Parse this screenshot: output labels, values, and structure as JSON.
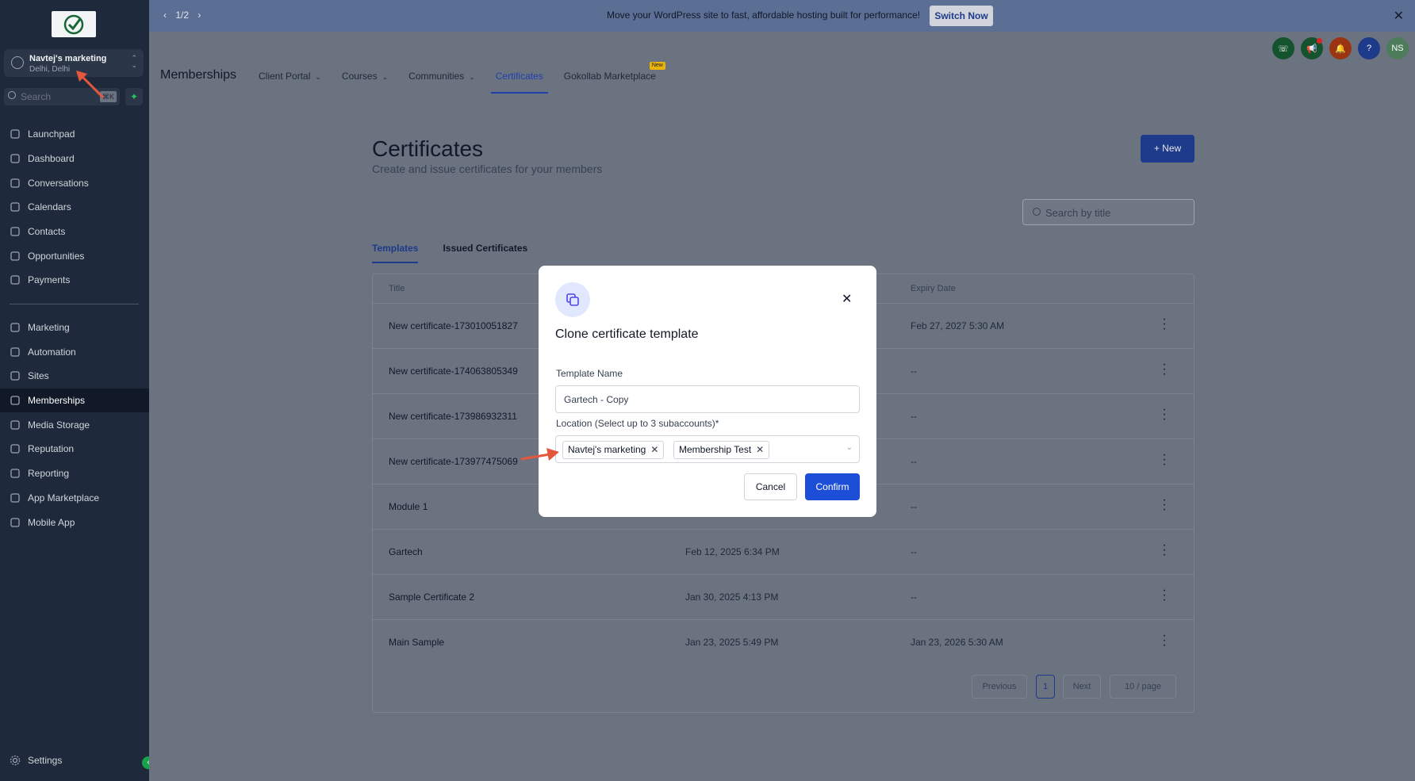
{
  "sidebar": {
    "account": {
      "name": "Navtej's marketing",
      "location": "Delhi, Delhi"
    },
    "search": {
      "placeholder": "Search",
      "shortcut": "⌘K"
    },
    "items": [
      {
        "label": "Launchpad",
        "icon": "rocket-icon"
      },
      {
        "label": "Dashboard",
        "icon": "grid-icon"
      },
      {
        "label": "Conversations",
        "icon": "chat-icon"
      },
      {
        "label": "Calendars",
        "icon": "calendar-icon"
      },
      {
        "label": "Contacts",
        "icon": "contacts-icon"
      },
      {
        "label": "Opportunities",
        "icon": "opportunities-icon"
      },
      {
        "label": "Payments",
        "icon": "payments-icon"
      },
      {
        "label": "Marketing",
        "icon": "send-icon"
      },
      {
        "label": "Automation",
        "icon": "automation-icon"
      },
      {
        "label": "Sites",
        "icon": "sites-icon"
      },
      {
        "label": "Memberships",
        "icon": "award-icon",
        "active": true
      },
      {
        "label": "Media Storage",
        "icon": "image-icon"
      },
      {
        "label": "Reputation",
        "icon": "star-icon"
      },
      {
        "label": "Reporting",
        "icon": "trend-icon"
      },
      {
        "label": "App Marketplace",
        "icon": "apps-icon"
      },
      {
        "label": "Mobile App",
        "icon": "mobile-icon"
      }
    ],
    "settings": "Settings"
  },
  "banner": {
    "pager": "1/2",
    "message": "Move your WordPress site to fast, affordable hosting built for performance!",
    "cta": "Switch Now"
  },
  "header": {
    "title": "Memberships",
    "tabs": [
      {
        "label": "Client Portal"
      },
      {
        "label": "Courses"
      },
      {
        "label": "Communities"
      },
      {
        "label": "Certificates"
      },
      {
        "label": "Gokollab Marketplace",
        "badge": "New"
      }
    ],
    "user_initials": "NS"
  },
  "main": {
    "title": "Certificates",
    "subtitle": "Create and issue certificates for your members",
    "new_button": "New",
    "search_placeholder": "Search by title",
    "tabs": [
      "Templates",
      "Issued Certificates"
    ],
    "columns": [
      "Title",
      "Expiry Date"
    ],
    "rows": [
      {
        "title": "New certificate-173010051827",
        "date": "",
        "expiry": "Feb 27, 2027 5:30 AM"
      },
      {
        "title": "New certificate-174063805349",
        "date": "",
        "expiry": "--"
      },
      {
        "title": "New certificate-173986932311",
        "date": "",
        "expiry": "--"
      },
      {
        "title": "New certificate-173977475069",
        "date": "",
        "expiry": "--"
      },
      {
        "title": "Module 1",
        "date": "",
        "expiry": "--"
      },
      {
        "title": "Gartech",
        "date": "Feb 12, 2025 6:34 PM",
        "expiry": "--"
      },
      {
        "title": "Sample Certificate 2",
        "date": "Jan 30, 2025 4:13 PM",
        "expiry": "--"
      },
      {
        "title": "Main Sample",
        "date": "Jan 23, 2025 5:49 PM",
        "expiry": "Jan 23, 2026 5:30 AM"
      }
    ],
    "pagination": {
      "previous": "Previous",
      "page": "1",
      "next": "Next",
      "page_size": "10 / page"
    }
  },
  "modal": {
    "title": "Clone certificate template",
    "template_name_label": "Template Name",
    "template_name_value": "Gartech - Copy",
    "location_label": "Location (Select up to 3 subaccounts)*",
    "locations": [
      "Navtej's marketing",
      "Membership Test"
    ],
    "cancel": "Cancel",
    "confirm": "Confirm"
  },
  "colors": {
    "accent": "#1d4ed8",
    "sidebar_bg": "#1e2a3b",
    "annotation_arrow": "#e4573d"
  }
}
